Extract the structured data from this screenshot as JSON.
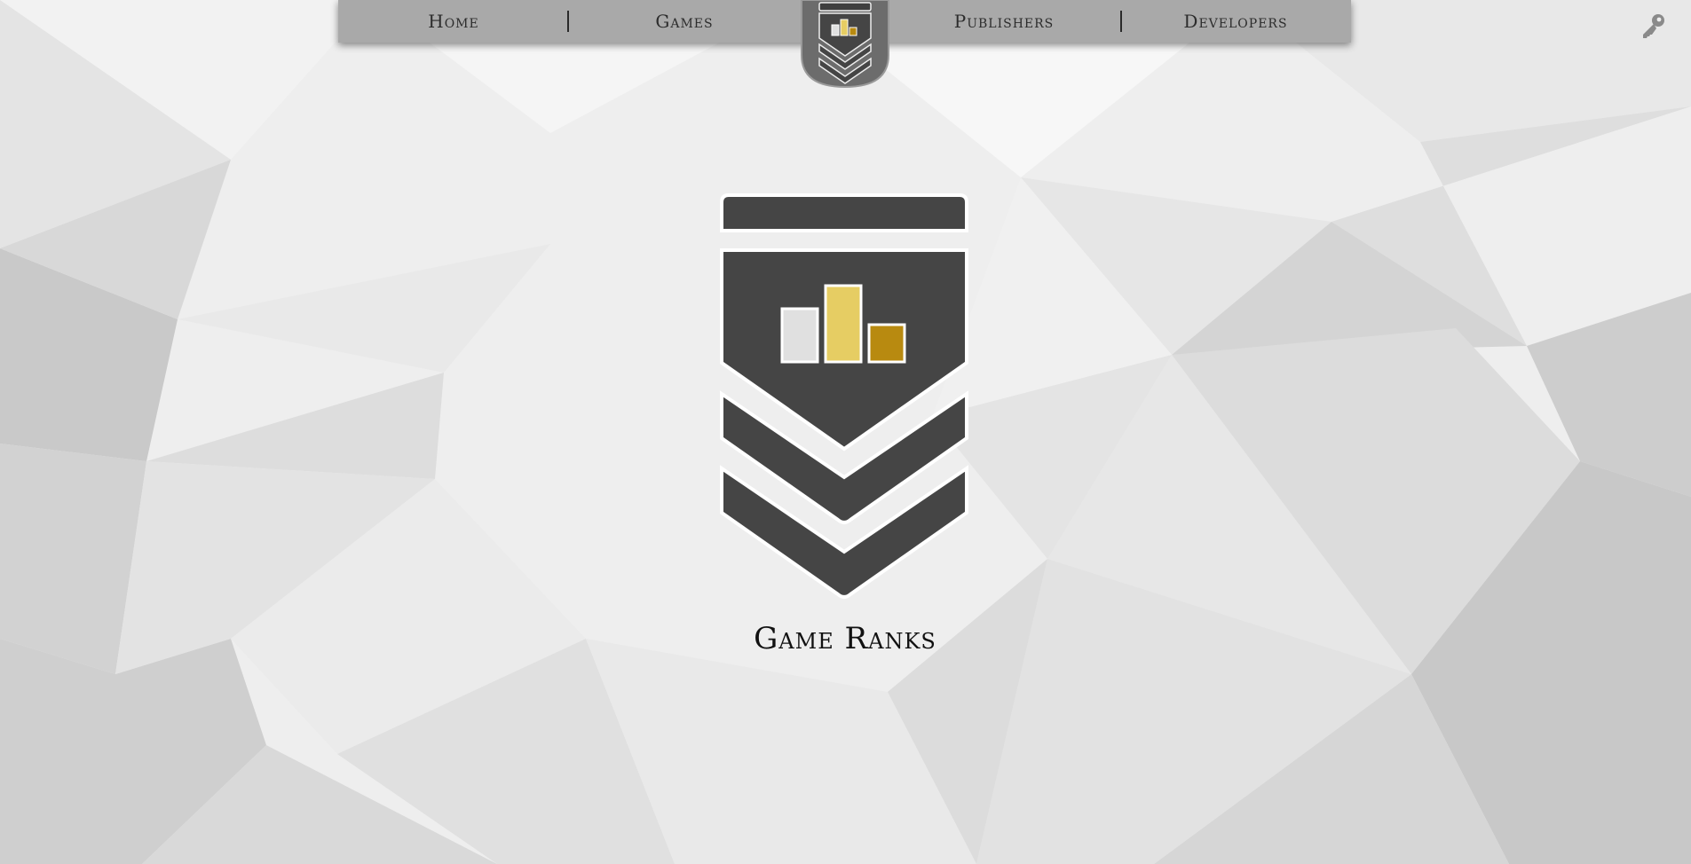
{
  "nav": {
    "items": [
      {
        "label": "Home"
      },
      {
        "label": "Games"
      },
      {
        "label": "Publishers"
      },
      {
        "label": "Developers"
      }
    ]
  },
  "logo": {
    "name": "rank-chevron-badge",
    "bar_colors": {
      "left": "#e0e0e0",
      "center": "#e6cd63",
      "right": "#b88a10"
    },
    "badge_color": "#454545"
  },
  "hero": {
    "title": "Game Ranks"
  },
  "header_right": {
    "icon": "key-icon"
  },
  "theme": {
    "navbar_bg": "#a9a9a9",
    "page_bg": "#ececec"
  }
}
